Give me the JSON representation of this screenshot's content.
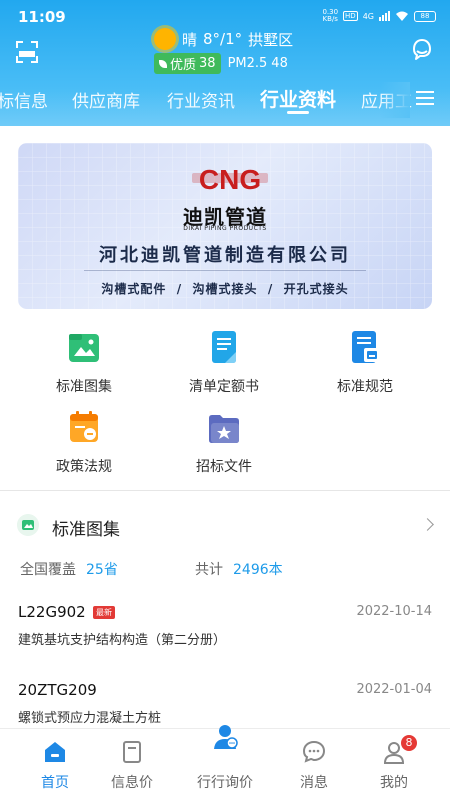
{
  "status_bar": {
    "time": "11:09",
    "net_speed_value": "0.30",
    "net_speed_unit": "KB/s",
    "hd_label": "HD",
    "network_label": "4G",
    "battery_level": "88"
  },
  "header": {
    "weather": {
      "condition": "晴",
      "temperature": "8°/1°",
      "location": "拱墅区",
      "aqi_label": "优质",
      "aqi_value": "38",
      "pm_label": "PM2.5",
      "pm_value": "48"
    },
    "tabs": [
      {
        "label": "标信息"
      },
      {
        "label": "供应商库"
      },
      {
        "label": "行业资讯"
      },
      {
        "label": "行业资料",
        "active": true
      },
      {
        "label": "应用工"
      }
    ]
  },
  "banner": {
    "logo_text": "CNG",
    "brand_cn": "迪凯管道",
    "brand_en": "DIKAI PIPING PRODUCTS",
    "company": "河北迪凯管道制造有限公司",
    "tagline": "沟槽式配件  /  沟槽式接头  /  开孔式接头"
  },
  "grid_menu": [
    {
      "label": "标准图集",
      "icon": "image-folder-icon"
    },
    {
      "label": "清单定额书",
      "icon": "document-icon"
    },
    {
      "label": "标准规范",
      "icon": "specification-icon"
    },
    {
      "label": "政策法规",
      "icon": "policy-calendar-icon"
    },
    {
      "label": "招标文件",
      "icon": "star-folder-icon"
    }
  ],
  "section": {
    "title": "标准图集",
    "coverage_label": "全国覆盖",
    "coverage_value": "25省",
    "total_label": "共计",
    "total_value": "2496本"
  },
  "documents": [
    {
      "code": "L22G902",
      "badge": "最新",
      "date": "2022-10-14",
      "title": "建筑基坑支护结构构造（第二分册）"
    },
    {
      "code": "20ZTG209",
      "date": "2022-01-04",
      "title": "螺锁式预应力混凝土方桩"
    }
  ],
  "bottom_nav": [
    {
      "label": "首页",
      "active": true
    },
    {
      "label": "信息价"
    },
    {
      "label": "行行询价"
    },
    {
      "label": "消息"
    },
    {
      "label": "我的",
      "badge": "8"
    }
  ],
  "colors": {
    "header_blue": "#22a8ef",
    "accent_blue": "#1e9be9",
    "badge_red": "#e53935"
  }
}
